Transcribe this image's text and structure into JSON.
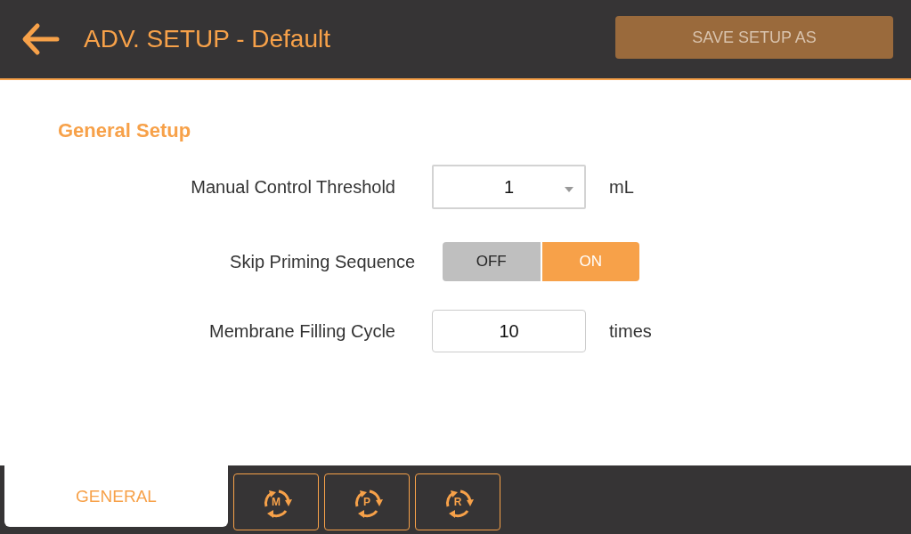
{
  "header": {
    "title": "ADV. SETUP - Default",
    "save_button": "SAVE SETUP AS"
  },
  "section_title": "General Setup",
  "settings": [
    {
      "kind": "select",
      "label": "Manual Control Threshold",
      "value": "1",
      "unit": "mL"
    },
    {
      "kind": "toggle",
      "label": "Skip Priming Sequence",
      "options": [
        {
          "label": "OFF",
          "selected": false
        },
        {
          "label": "ON",
          "selected": true
        }
      ]
    },
    {
      "kind": "number",
      "label": "Membrane Filling Cycle",
      "value": "10",
      "unit": "times"
    }
  ],
  "tabs": [
    {
      "kind": "text",
      "label": "GENERAL",
      "selected": true
    },
    {
      "kind": "cycle",
      "label": "M",
      "selected": false
    },
    {
      "kind": "cycle",
      "label": "P",
      "selected": false
    },
    {
      "kind": "cycle",
      "label": "R",
      "selected": false
    }
  ]
}
